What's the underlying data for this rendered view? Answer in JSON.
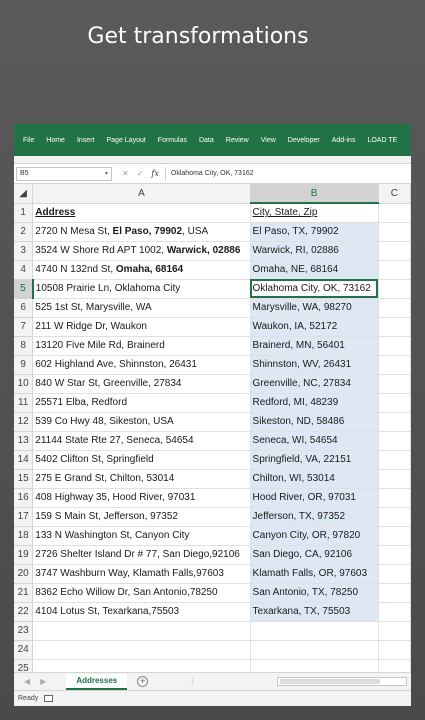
{
  "slide": {
    "title": "Get transformations"
  },
  "ribbon": {
    "tabs": [
      "File",
      "Home",
      "Insert",
      "Page Layout",
      "Formulas",
      "Data",
      "Review",
      "View",
      "Developer",
      "Add-ins",
      "LOAD TE"
    ]
  },
  "formula_bar": {
    "name_box": "B5",
    "cancel": "✕",
    "enter": "✓",
    "fx": "fx",
    "value": "Oklahoma City, OK, 73162"
  },
  "columns": [
    "A",
    "B",
    "C"
  ],
  "rows": [
    {
      "num": "1",
      "a_parts": [
        {
          "t": "Address",
          "b": true
        }
      ],
      "b": "City, State, Zip",
      "header": true
    },
    {
      "num": "2",
      "a_parts": [
        {
          "t": "2720 N Mesa St, ",
          "b": false
        },
        {
          "t": "El Paso, 79902",
          "b": true
        },
        {
          "t": ", USA",
          "b": false
        }
      ],
      "b": "El Paso, TX, 79902"
    },
    {
      "num": "3",
      "a_parts": [
        {
          "t": "3524 W Shore Rd APT 1002, ",
          "b": false
        },
        {
          "t": "Warwick, 02886",
          "b": true
        }
      ],
      "b": "Warwick, RI, 02886"
    },
    {
      "num": "4",
      "a_parts": [
        {
          "t": "4740 N 132nd St, ",
          "b": false
        },
        {
          "t": "Omaha, 68164",
          "b": true
        }
      ],
      "b": "Omaha, NE, 68164"
    },
    {
      "num": "5",
      "a_parts": [
        {
          "t": "10508 Prairie Ln, Oklahoma City",
          "b": false
        }
      ],
      "b": "Oklahoma City, OK, 73162",
      "active": true
    },
    {
      "num": "6",
      "a_parts": [
        {
          "t": "525 1st St, Marysville, WA",
          "b": false
        }
      ],
      "b": "Marysville, WA, 98270"
    },
    {
      "num": "7",
      "a_parts": [
        {
          "t": "211 W Ridge Dr, Waukon",
          "b": false
        }
      ],
      "b": "Waukon, IA, 52172"
    },
    {
      "num": "8",
      "a_parts": [
        {
          "t": "13120 Five Mile Rd, Brainerd",
          "b": false
        }
      ],
      "b": "Brainerd, MN, 56401"
    },
    {
      "num": "9",
      "a_parts": [
        {
          "t": "602 Highland Ave, Shinnston, 26431",
          "b": false
        }
      ],
      "b": "Shinnston, WV, 26431"
    },
    {
      "num": "10",
      "a_parts": [
        {
          "t": "840 W Star St, Greenville, 27834",
          "b": false
        }
      ],
      "b": "Greenville, NC, 27834"
    },
    {
      "num": "11",
      "a_parts": [
        {
          "t": "25571 Elba, Redford",
          "b": false
        }
      ],
      "b": "Redford, MI, 48239"
    },
    {
      "num": "12",
      "a_parts": [
        {
          "t": "539 Co Hwy 48, Sikeston, USA",
          "b": false
        }
      ],
      "b": "Sikeston, ND, 58486"
    },
    {
      "num": "13",
      "a_parts": [
        {
          "t": "21144 State Rte 27, Seneca, 54654",
          "b": false
        }
      ],
      "b": "Seneca, WI, 54654"
    },
    {
      "num": "14",
      "a_parts": [
        {
          "t": "5402 Clifton St, Springfield",
          "b": false
        }
      ],
      "b": "Springfield, VA, 22151"
    },
    {
      "num": "15",
      "a_parts": [
        {
          "t": "275 E Grand St, Chilton, 53014",
          "b": false
        }
      ],
      "b": "Chilton, WI, 53014"
    },
    {
      "num": "16",
      "a_parts": [
        {
          "t": "408 Highway 35, Hood River, 97031",
          "b": false
        }
      ],
      "b": "Hood River, OR, 97031"
    },
    {
      "num": "17",
      "a_parts": [
        {
          "t": "159 S Main St, Jefferson, 97352",
          "b": false
        }
      ],
      "b": "Jefferson, TX, 97352"
    },
    {
      "num": "18",
      "a_parts": [
        {
          "t": "133 N Washington St, Canyon City",
          "b": false
        }
      ],
      "b": "Canyon City, OR, 97820"
    },
    {
      "num": "19",
      "a_parts": [
        {
          "t": "2726 Shelter Island Dr # 77, San Diego,92106",
          "b": false
        }
      ],
      "b": "San Diego, CA, 92106"
    },
    {
      "num": "20",
      "a_parts": [
        {
          "t": "3747 Washburn Way, Klamath Falls,97603",
          "b": false
        }
      ],
      "b": "Klamath Falls, OR, 97603"
    },
    {
      "num": "21",
      "a_parts": [
        {
          "t": "8362 Echo Willow Dr, San Antonio,78250",
          "b": false
        }
      ],
      "b": "San Antonio, TX, 78250"
    },
    {
      "num": "22",
      "a_parts": [
        {
          "t": "4104 Lotus St, Texarkana,75503",
          "b": false
        }
      ],
      "b": "Texarkana, TX, 75503"
    },
    {
      "num": "23",
      "a_parts": [],
      "b": ""
    },
    {
      "num": "24",
      "a_parts": [],
      "b": ""
    },
    {
      "num": "25",
      "a_parts": [],
      "b": ""
    }
  ],
  "sheet_bar": {
    "prev": "◀",
    "next": "▶",
    "tab": "Addresses",
    "add": "+",
    "dots": "⋮"
  },
  "status": {
    "text": "Ready"
  },
  "colors": {
    "excel_green": "#217346",
    "selection_blue": "#dde8f4"
  }
}
